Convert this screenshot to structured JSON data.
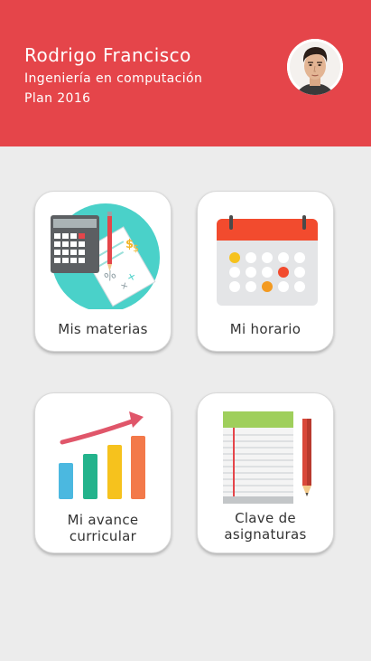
{
  "profile": {
    "name": "Rodrigo Francisco",
    "career": "Ingeniería en computación",
    "plan": "Plan 2016"
  },
  "menu": [
    {
      "label": "Mis materias",
      "icon": "calculator-notes-icon"
    },
    {
      "label": "Mi horario",
      "icon": "calendar-icon"
    },
    {
      "label_line1": "Mi avance",
      "label_line2": "curricular",
      "icon": "progress-chart-icon"
    },
    {
      "label_line1": "Clave de",
      "label_line2": "asignaturas",
      "icon": "notebook-pencil-icon"
    }
  ],
  "colors": {
    "header": "#e5454a",
    "background": "#ececec",
    "card": "#ffffff"
  }
}
